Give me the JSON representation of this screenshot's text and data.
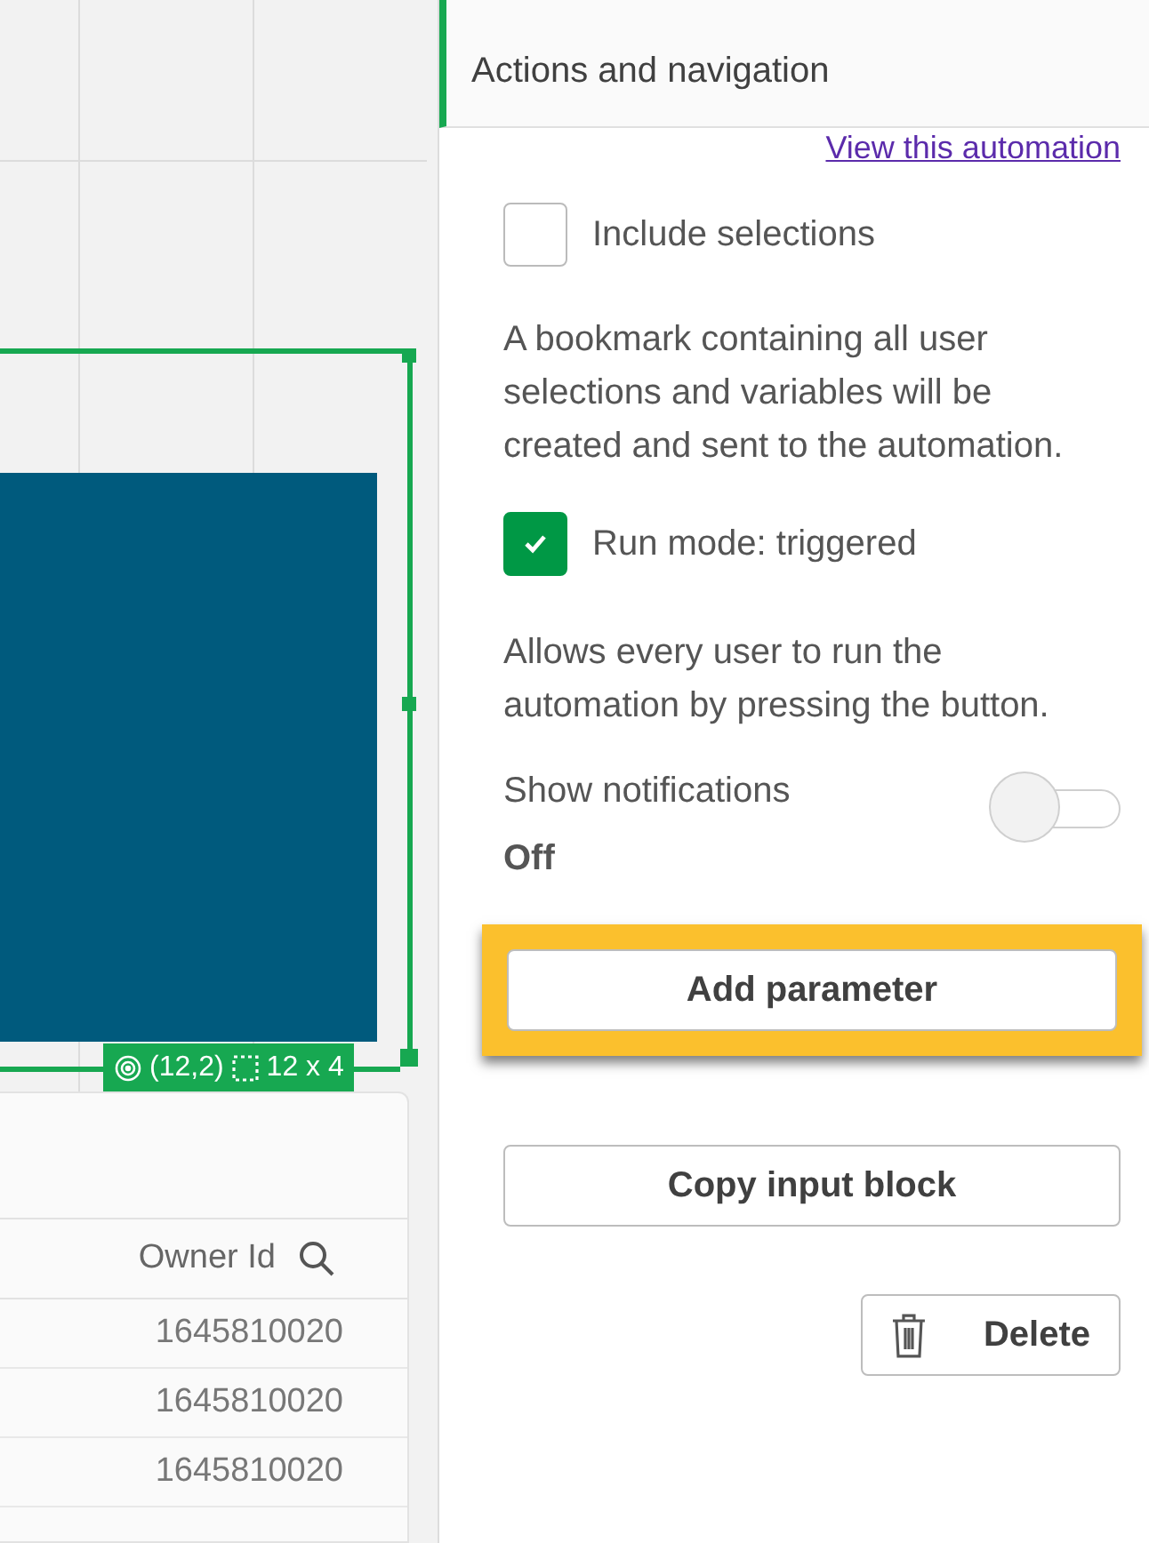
{
  "canvas": {
    "selection": {
      "position": "(12,2)",
      "size": "12 x 4"
    }
  },
  "table": {
    "columns": [
      "Owner Id"
    ],
    "rows": [
      "1645810020",
      "1645810020",
      "1645810020"
    ]
  },
  "panel": {
    "title": "Actions and navigation",
    "link": "View this automation",
    "include_selections": {
      "label": "Include selections",
      "checked": false
    },
    "include_description": "A bookmark containing all user selections and variables will be created and sent to the automation.",
    "run_mode": {
      "label": "Run mode: triggered",
      "checked": true
    },
    "run_mode_description": "Allows every user to run the automation by pressing the button.",
    "notifications": {
      "label": "Show notifications",
      "on": false,
      "value": "Off"
    },
    "buttons": [
      {
        "label": "Add parameter",
        "kind": "plain",
        "highlighted": true
      },
      {
        "label": "Copy input block",
        "kind": "plain",
        "highlighted": false
      },
      {
        "label": "Delete",
        "kind": "delete",
        "highlighted": false
      }
    ]
  }
}
